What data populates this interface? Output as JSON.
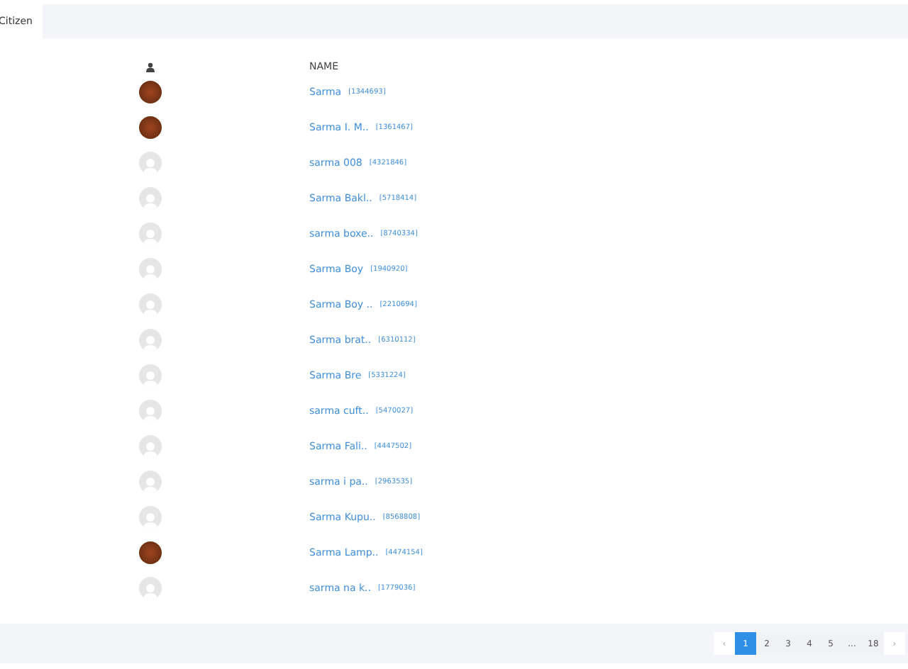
{
  "tabs": [
    {
      "label": "Citizen",
      "selected": true
    }
  ],
  "table": {
    "columns": [
      "NAME"
    ],
    "rows": [
      {
        "kind": "photo",
        "name": "Sarma",
        "id": "[1344693]"
      },
      {
        "kind": "photo",
        "name": "Sarma I. M..",
        "id": "[1361467]"
      },
      {
        "kind": "default",
        "name": "sarma 008",
        "id": "[4321846]"
      },
      {
        "kind": "default",
        "name": "Sarma Bakl..",
        "id": "[5718414]"
      },
      {
        "kind": "default",
        "name": "sarma boxe..",
        "id": "[8740334]"
      },
      {
        "kind": "default",
        "name": "Sarma Boy",
        "id": "[1940920]"
      },
      {
        "kind": "default",
        "name": "Sarma Boy ..",
        "id": "[2210694]"
      },
      {
        "kind": "default",
        "name": "Sarma brat..",
        "id": "[6310112]"
      },
      {
        "kind": "default",
        "name": "Sarma Bre",
        "id": "[5331224]"
      },
      {
        "kind": "default",
        "name": "sarma cuft..",
        "id": "[5470027]"
      },
      {
        "kind": "default",
        "name": "Sarma Fali..",
        "id": "[4447502]"
      },
      {
        "kind": "default",
        "name": "sarma i pa..",
        "id": "[2963535]"
      },
      {
        "kind": "default",
        "name": "Sarma Kupu..",
        "id": "[8568808]"
      },
      {
        "kind": "photo",
        "name": "Sarma Lamp..",
        "id": "[4474154]"
      },
      {
        "kind": "default",
        "name": "sarma na k..",
        "id": "[1779036]"
      }
    ]
  },
  "pagination": {
    "prev": "‹",
    "next": "›",
    "pages": [
      {
        "label": "1",
        "selected": true
      },
      {
        "label": "2",
        "selected": false
      },
      {
        "label": "3",
        "selected": false
      },
      {
        "label": "4",
        "selected": false
      },
      {
        "label": "5",
        "selected": false
      },
      {
        "label": "...",
        "selected": false
      },
      {
        "label": "18",
        "selected": false
      }
    ]
  }
}
